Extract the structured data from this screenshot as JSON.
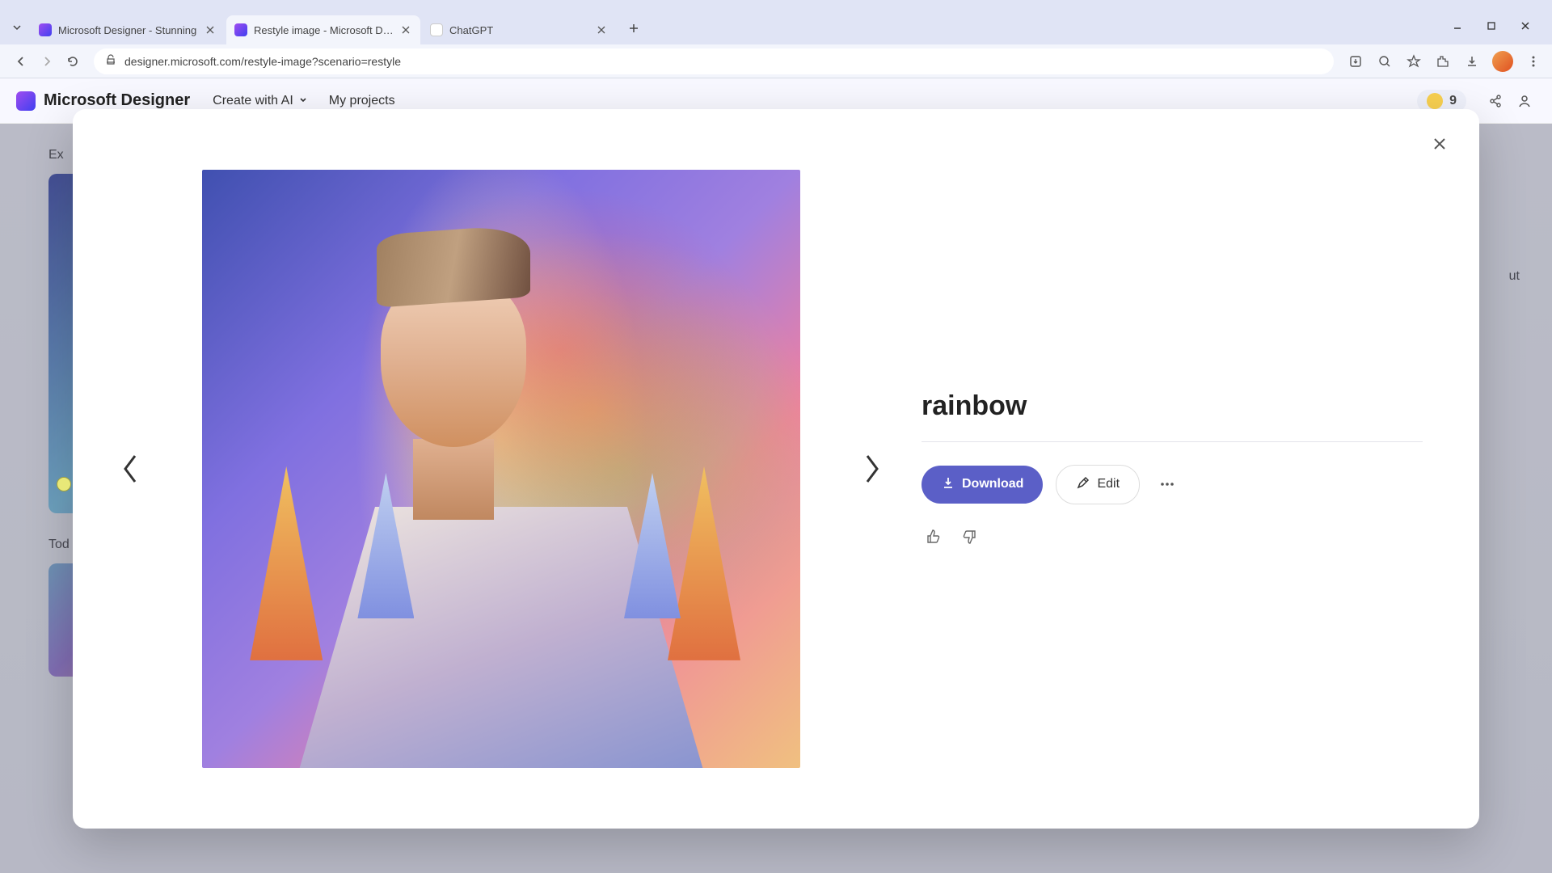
{
  "browser": {
    "tabs": [
      {
        "title": "Microsoft Designer - Stunning",
        "active": false
      },
      {
        "title": "Restyle image - Microsoft Desi",
        "active": true
      },
      {
        "title": "ChatGPT",
        "active": false
      }
    ],
    "url": "designer.microsoft.com/restyle-image?scenario=restyle"
  },
  "app": {
    "title": "Microsoft Designer",
    "nav": {
      "create_label": "Create with AI",
      "projects_label": "My projects"
    },
    "credits": "9"
  },
  "backdrop": {
    "section1": "Ex",
    "section2": "Tod",
    "section3": "ut"
  },
  "modal": {
    "title": "rainbow",
    "download_label": "Download",
    "edit_label": "Edit"
  }
}
